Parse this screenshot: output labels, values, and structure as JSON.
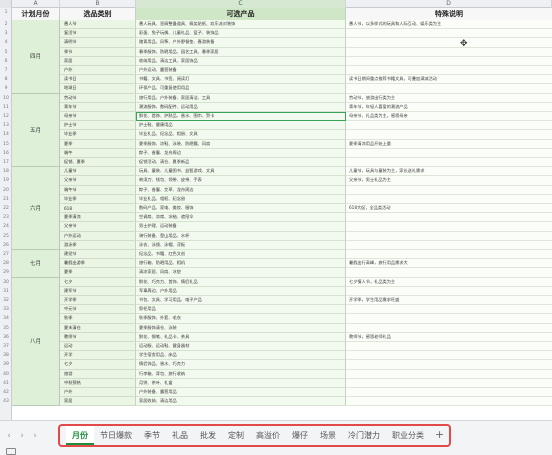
{
  "column_headers": {
    "columns": [
      "A",
      "B",
      "C",
      "D"
    ],
    "labels": [
      "计划月份",
      "选品类别",
      "可选产品",
      "特殊说明"
    ]
  },
  "row_numbers": [
    "1",
    "2",
    "3",
    "4",
    "5",
    "6",
    "7",
    "8",
    "9",
    "10",
    "11",
    "12",
    "13",
    "14",
    "15",
    "16",
    "17",
    "18",
    "19",
    "20",
    "21",
    "22",
    "23",
    "24",
    "25",
    "26",
    "27",
    "28",
    "29",
    "30",
    "31",
    "32",
    "33",
    "34",
    "35",
    "36",
    "37",
    "38",
    "39",
    "40",
    "41",
    "42",
    "43"
  ],
  "months": [
    {
      "label": "四月",
      "rows": 8
    },
    {
      "label": "五月",
      "rows": 8
    },
    {
      "label": "六月",
      "rows": 9
    },
    {
      "label": "七月",
      "rows": 3
    },
    {
      "label": "八月",
      "rows": 14
    }
  ],
  "rows": [
    {
      "cat": "愚人节",
      "prod": "愚人玩具、恶搞整蛊道具、搞笑贴纸、欢乐派对装饰",
      "note": "愚人节，以多样式的玩具和人际互动、娱乐类为主"
    },
    {
      "cat": "复活节",
      "prod": "彩蛋、兔子玩偶、儿童礼品、篮子、装饰品",
      "note": ""
    },
    {
      "cat": "清明节",
      "prod": "踏青用品、风筝、户外野餐垫、春游装备",
      "note": ""
    },
    {
      "cat": "季节",
      "prod": "春季服饰、防晒用品、园艺工具、春季家居",
      "note": ""
    },
    {
      "cat": "家居",
      "prod": "收纳用品、清洁工具、家居饰品",
      "note": ""
    },
    {
      "cat": "户外",
      "prod": "户外运动、露营装备",
      "note": ""
    },
    {
      "cat": "读书日",
      "prod": "书籍、文具、书签、阅读灯",
      "note": "读书日期间重点推荐书籍文具，可叠加满减活动"
    },
    {
      "cat": "地球日",
      "prod": "环保产品、可重复使用用品",
      "note": ""
    },
    {
      "cat": "劳动节",
      "prod": "旅行用品、户外装备、家居清洁、工具",
      "note": "劳动节，旅游出行类为主"
    },
    {
      "cat": "青年节",
      "prod": "潮流服饰、数码配件、运动用品",
      "note": "青年节，年轻人喜爱的潮流产品"
    },
    {
      "cat": "母亲节",
      "prod": "鲜花、首饰、护肤品、香水、围巾、贺卡",
      "note": "母亲节，礼品类为主，感恩母亲"
    },
    {
      "cat": "护士节",
      "prod": "护士鞋、健康用品",
      "note": ""
    },
    {
      "cat": "毕业季",
      "prod": "毕业礼品、纪念品、相册、文具",
      "note": ""
    },
    {
      "cat": "夏季",
      "prod": "夏季服饰、凉鞋、泳装、防晒霜、风扇",
      "note": "夏季清凉用品开始上量"
    },
    {
      "cat": "端午",
      "prod": "粽子、香囊、龙舟周边",
      "note": ""
    },
    {
      "cat": "促销、夏季",
      "prod": "促销活动、清仓、夏季新品",
      "note": ""
    },
    {
      "cat": "儿童节",
      "prod": "玩具、童装、儿童图书、益智游戏、文具",
      "note": "儿童节，玩具与童装为主，家长送礼需求"
    },
    {
      "cat": "父亲节",
      "prod": "剃须刀、钱包、领带、皮带、手表",
      "note": "父亲节，男士礼品为主"
    },
    {
      "cat": "端午节",
      "prod": "粽子、香囊、艾草、龙舟周边",
      "note": ""
    },
    {
      "cat": "毕业季",
      "prod": "毕业礼品、相框、纪念册",
      "note": ""
    },
    {
      "cat": "618",
      "prod": "数码产品、家电、美妆、服饰",
      "note": "618大促，全品类活动"
    },
    {
      "cat": "夏季清凉",
      "prod": "空调扇、凉席、冰袖、遮阳伞",
      "note": ""
    },
    {
      "cat": "父亲节",
      "prod": "男士护理、运动装备",
      "note": ""
    },
    {
      "cat": "户外运动",
      "prod": "骑行装备、登山用品、水杯",
      "note": ""
    },
    {
      "cat": "游泳季",
      "prod": "泳衣、泳镜、泳帽、浮板",
      "note": ""
    },
    {
      "cat": "建党节",
      "prod": "纪念品、书籍、红色文创",
      "note": ""
    },
    {
      "cat": "暑假出游季",
      "prod": "旅行箱、防晒用品、相机",
      "note": "暑假出行高峰，旅行用品需求大"
    },
    {
      "cat": "夏季",
      "prod": "清凉家居、风扇、冰垫",
      "note": ""
    },
    {
      "cat": "七夕",
      "prod": "鲜花、巧克力、首饰、情侣礼品",
      "note": "七夕情人节，礼品类为主"
    },
    {
      "cat": "建军节",
      "prod": "军事周边、户外用品",
      "note": ""
    },
    {
      "cat": "开学季",
      "prod": "书包、文具、学习用品、电子产品",
      "note": "开学季，学生用品需求旺盛"
    },
    {
      "cat": "中元节",
      "prod": "祭祀用品",
      "note": ""
    },
    {
      "cat": "秋季",
      "prod": "秋季服饰、外套、毛衣",
      "note": ""
    },
    {
      "cat": "夏末清仓",
      "prod": "夏季服饰清仓、泳装",
      "note": ""
    },
    {
      "cat": "教师节",
      "prod": "鲜花、钢笔、礼品卡、茶具",
      "note": "教师节，感恩老师礼品"
    },
    {
      "cat": "运动",
      "prod": "运动服、运动鞋、健身器材",
      "note": ""
    },
    {
      "cat": "开学",
      "prod": "学生宿舍用品、床品",
      "note": ""
    },
    {
      "cat": "七夕",
      "prod": "情侣饰品、香水、巧克力",
      "note": ""
    },
    {
      "cat": "旅游",
      "prod": "行李箱、背包、旅行收纳",
      "note": ""
    },
    {
      "cat": "中秋预热",
      "prod": "月饼、茶叶、礼盒",
      "note": ""
    },
    {
      "cat": "户外",
      "prod": "户外装备、露营用品",
      "note": ""
    },
    {
      "cat": "家居",
      "prod": "家居收纳、清洁用品",
      "note": ""
    }
  ],
  "sheet_tabs": [
    "月份",
    "节日爆款",
    "季节",
    "礼品",
    "批发",
    "定制",
    "高溢价",
    "爆仔",
    "场景",
    "冷门潜力",
    "职业分类"
  ],
  "active_tab_index": 0,
  "add_tab_label": "+",
  "nav_arrows": [
    "‹",
    "›",
    "›"
  ],
  "colors": {
    "header_green": "#cfe7c6",
    "band_green": "#dff0d8",
    "selection": "#3aa35a",
    "tab_highlight": "#e24a4a",
    "active_tab_text": "#1e8e3e"
  }
}
